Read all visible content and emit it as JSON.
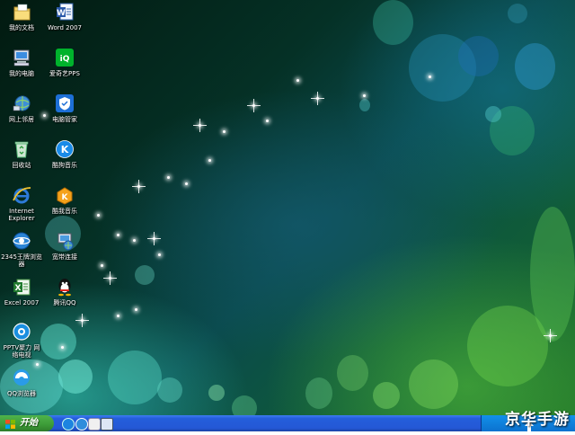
{
  "desktop": {
    "icons": [
      {
        "label": "我的文档",
        "icon": "my-documents-icon"
      },
      {
        "label": "Word 2007",
        "icon": "word-icon"
      },
      {
        "label": "我的电脑",
        "icon": "my-computer-icon"
      },
      {
        "label": "爱奇艺PPS",
        "icon": "iqiyi-icon"
      },
      {
        "label": "网上邻居",
        "icon": "network-places-icon"
      },
      {
        "label": "电脑管家",
        "icon": "pc-manager-icon"
      },
      {
        "label": "回收站",
        "icon": "recycle-bin-icon"
      },
      {
        "label": "酷狗音乐",
        "icon": "kugou-icon"
      },
      {
        "label": "Internet Explorer",
        "icon": "internet-explorer-icon"
      },
      {
        "label": "酷我音乐",
        "icon": "kuwo-icon"
      },
      {
        "label": "2345王牌浏览器",
        "icon": "browser-2345-icon"
      },
      {
        "label": "宽带连接",
        "icon": "broadband-icon"
      },
      {
        "label": "Excel 2007",
        "icon": "excel-icon"
      },
      {
        "label": "腾讯QQ",
        "icon": "qq-icon"
      },
      {
        "label": "PPTV聚力 网络电视",
        "icon": "pptv-icon"
      },
      {
        "label": "QQ浏览器",
        "icon": "qq-browser-icon"
      }
    ]
  },
  "taskbar": {
    "start_label": "开始",
    "quick_launch": [
      "browser-icon",
      "ie-icon",
      "media-icon",
      "desktop-icon"
    ]
  },
  "watermark": "京华手游",
  "colors": {
    "taskbar_blue": "#245edb",
    "start_green": "#3c9b37",
    "tray_blue": "#0c72cf"
  }
}
